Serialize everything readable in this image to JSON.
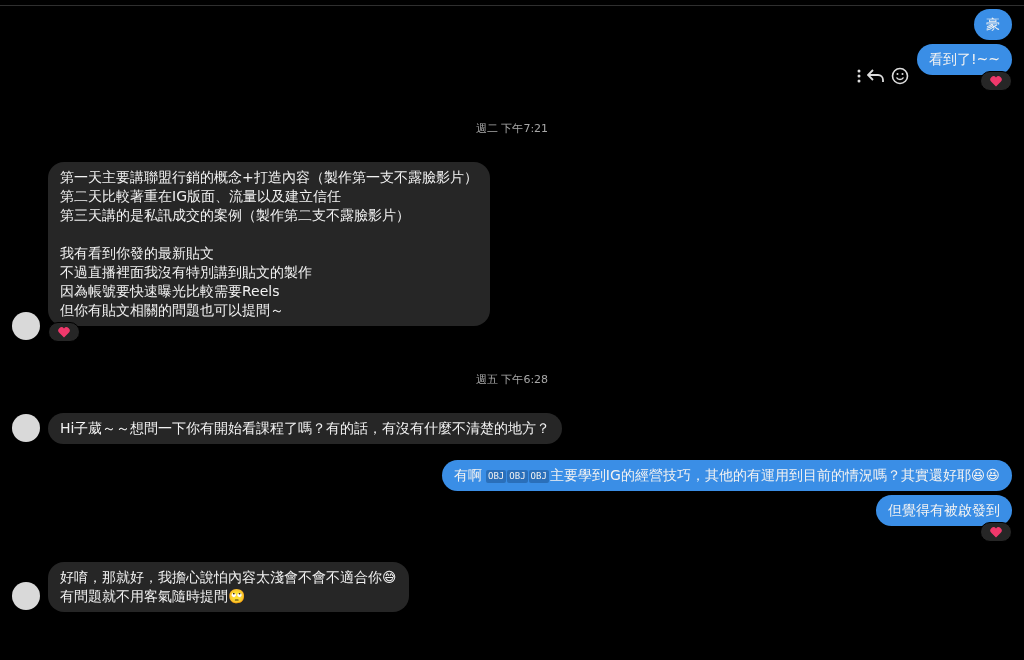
{
  "messages": [
    {
      "kind": "outgoing",
      "paragraphs": [
        [
          "豪"
        ]
      ]
    },
    {
      "kind": "outgoing",
      "paragraphs": [
        [
          "看到了!~~"
        ]
      ],
      "reacted": true,
      "show_actions": true
    },
    {
      "kind": "timestamp",
      "text": "週二 下午7:21"
    },
    {
      "kind": "incoming",
      "paragraphs": [
        [
          "第一天主要講聯盟行銷的概念+打造內容（製作第一支不露臉影片）",
          "第二天比較著重在IG版面、流量以及建立信任",
          "第三天講的是私訊成交的案例（製作第二支不露臉影片）"
        ],
        [
          "我有看到你發的最新貼文",
          "不過直播裡面我沒有特別講到貼文的製作",
          "因為帳號要快速曝光比較需要Reels",
          "但你有貼文相關的問題也可以提問～"
        ]
      ],
      "reacted": true
    },
    {
      "kind": "timestamp",
      "text": "週五 下午6:28"
    },
    {
      "kind": "incoming",
      "paragraphs": [
        [
          "Hi子葳～～想問一下你有開始看課程了嗎？有的話，有沒有什麼不清楚的地方？"
        ]
      ]
    },
    {
      "kind": "outgoing",
      "paragraphs": [
        [
          [
            {
              "kind": "text",
              "text": "有啊 "
            },
            {
              "kind": "object",
              "label": "OBJ"
            },
            {
              "kind": "object",
              "label": "OBJ"
            },
            {
              "kind": "object",
              "label": "OBJ"
            },
            {
              "kind": "text",
              "text": "主要學到IG的經營技巧，其他的有運用到目前的情況嗎？其實還好耶😆😆"
            }
          ]
        ]
      ]
    },
    {
      "kind": "outgoing",
      "paragraphs": [
        [
          "但覺得有被啟發到"
        ]
      ],
      "reacted": true
    },
    {
      "kind": "incoming",
      "paragraphs": [
        [
          "好唷，那就好，我擔心說怕內容太淺會不會不適合你😅",
          "有問題就不用客氣隨時提問🙄"
        ]
      ]
    }
  ]
}
